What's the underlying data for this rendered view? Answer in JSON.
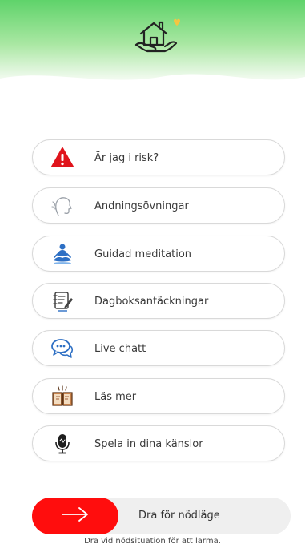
{
  "colors": {
    "header_green_top": "#5fd36a",
    "header_green_bottom": "#e9f8e6",
    "alert_red": "#e0141c",
    "emergency_red": "#ff0d0d",
    "icon_blue": "#2d6fc4",
    "heart_yellow": "#f5c542"
  },
  "header": {
    "logo_icon": "house-in-hand-icon"
  },
  "menu": [
    {
      "label": "Är jag i risk?",
      "icon": "warning-icon"
    },
    {
      "label": "Andningsövningar",
      "icon": "breathing-head-icon"
    },
    {
      "label": "Guidad meditation",
      "icon": "meditation-icon"
    },
    {
      "label": "Dagboksantäckningar",
      "icon": "notebook-icon"
    },
    {
      "label": "Live chatt",
      "icon": "chat-bubbles-icon"
    },
    {
      "label": "Läs mer",
      "icon": "open-book-icon"
    },
    {
      "label": "Spela in dina känslor",
      "icon": "microphone-icon"
    }
  ],
  "emergency": {
    "slider_label": "Dra för nödläge",
    "knob_icon": "arrow-right-icon",
    "hint": "Dra vid nödsituation för att larma."
  }
}
